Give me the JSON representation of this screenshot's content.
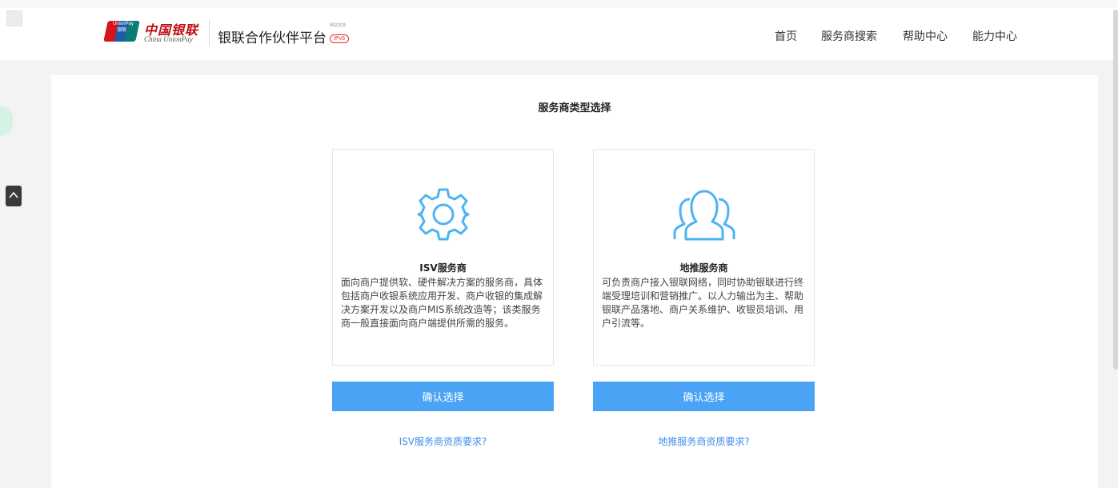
{
  "header": {
    "brand_cn": "中国银联",
    "brand_en": "China UnionPay",
    "logo_text_top": "UnionPay",
    "logo_text_bottom": "银联",
    "platform_title": "银联合作伙伴平台",
    "ipv6_small": "网站支持",
    "ipv6_badge": "IPv6",
    "nav": [
      {
        "label": "首页"
      },
      {
        "label": "服务商搜索"
      },
      {
        "label": "帮助中心"
      },
      {
        "label": "能力中心"
      }
    ]
  },
  "main": {
    "title": "服务商类型选择",
    "cards": [
      {
        "icon": "gear-icon",
        "title": "ISV服务商",
        "desc": "面向商户提供软、硬件解决方案的服务商，具体包括商户收银系统应用开发、商户收银的集成解决方案开发以及商户MIS系统改造等；该类服务商一般直接面向商户端提供所需的服务。",
        "button": "确认选择",
        "link": "ISV服务商资质要求?"
      },
      {
        "icon": "users-icon",
        "title": "地推服务商",
        "desc": "可负责商户接入银联网络，同时协助银联进行终端受理培训和营销推广。以人力输出为主、帮助银联产品落地、商户关系维护、收银员培训、用户引流等。",
        "button": "确认选择",
        "link": "地推服务商资质要求?"
      }
    ]
  },
  "colors": {
    "accent": "#4aa3f5",
    "link": "#3f8ee8",
    "icon": "#4db3f2",
    "brand_red": "#c00c13"
  }
}
